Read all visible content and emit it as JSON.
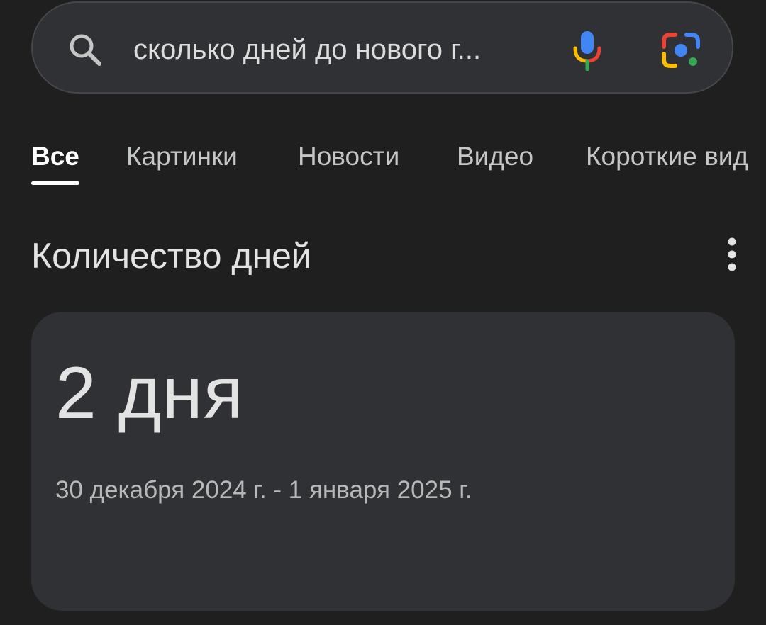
{
  "search": {
    "query": "сколько дней до нового г...",
    "icons": {
      "search": "search-icon",
      "voice": "microphone-icon",
      "lens": "google-lens-icon"
    }
  },
  "tabs": [
    {
      "label": "Все",
      "active": true
    },
    {
      "label": "Картинки",
      "active": false
    },
    {
      "label": "Новости",
      "active": false
    },
    {
      "label": "Видео",
      "active": false
    },
    {
      "label": "Короткие вид",
      "active": false
    }
  ],
  "section": {
    "title": "Количество дней",
    "menu_icon": "more-vertical-icon"
  },
  "result": {
    "value": "2 дня",
    "date_range": "30 декабря 2024 г. - 1 января 2025 г."
  },
  "colors": {
    "background": "#1f1f1f",
    "surface": "#303134",
    "text_primary": "#e3e3e3",
    "text_secondary": "#c4c7c5",
    "google_blue": "#4285f4",
    "google_red": "#ea4335",
    "google_yellow": "#fbbc05",
    "google_green": "#34a853"
  }
}
